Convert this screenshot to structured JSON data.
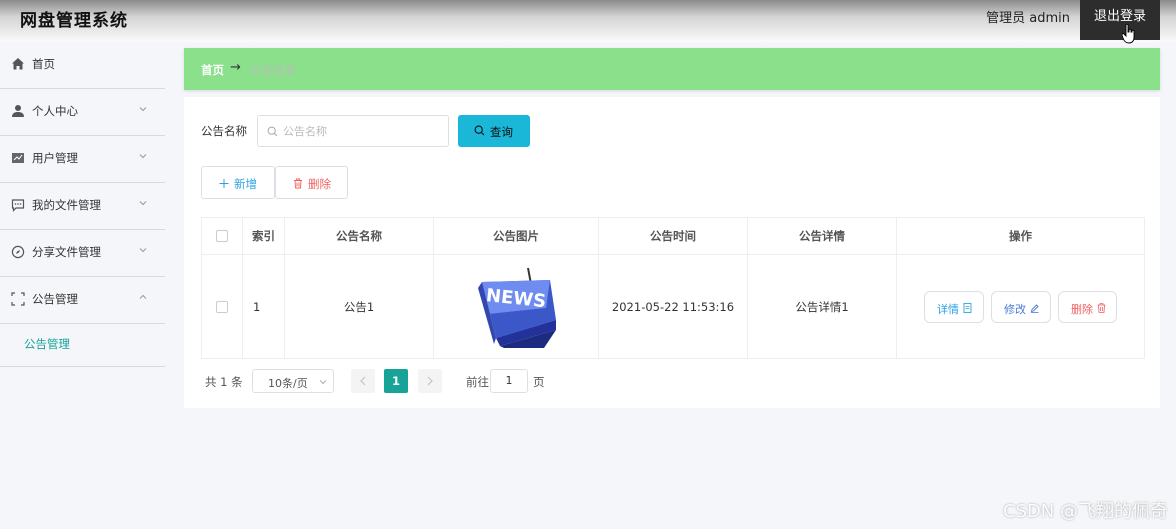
{
  "header": {
    "app_title": "网盘管理系统",
    "admin_label": "管理员 admin",
    "logout_label": "退出登录"
  },
  "sidebar": {
    "items": [
      {
        "label": "首页",
        "icon": "home-icon"
      },
      {
        "label": "个人中心",
        "icon": "user-icon"
      },
      {
        "label": "用户管理",
        "icon": "chart-icon"
      },
      {
        "label": "我的文件管理",
        "icon": "chat-icon"
      },
      {
        "label": "分享文件管理",
        "icon": "compass-icon"
      },
      {
        "label": "公告管理",
        "icon": "fullscreen-icon",
        "expanded": true
      }
    ],
    "sub_items": [
      {
        "label": "公告管理",
        "active": true
      }
    ]
  },
  "breadcrumb": {
    "home": "首页",
    "separator": "→",
    "current": "公告信息"
  },
  "search": {
    "label": "公告名称",
    "placeholder": "公告名称",
    "value": "",
    "button_label": "查询"
  },
  "actions": {
    "add_label": "新增",
    "delete_label": "删除"
  },
  "table": {
    "columns": [
      "索引",
      "公告名称",
      "公告图片",
      "公告时间",
      "公告详情",
      "操作"
    ],
    "rows": [
      {
        "index": "1",
        "name": "公告1",
        "image": "NEWS",
        "time": "2021-05-22 11:53:16",
        "detail": "公告详情1",
        "ops": {
          "detail": "详情",
          "edit": "修改",
          "delete": "删除"
        }
      }
    ]
  },
  "pagination": {
    "total": "共 1 条",
    "page_size": "10条/页",
    "current_page": "1",
    "goto_label": "前往",
    "goto_value": "1",
    "goto_suffix": "页"
  },
  "watermark": "CSDN @飞翔的佩奇",
  "colors": {
    "breadcrumb_bg": "#8be08b",
    "primary_teal": "#17a398",
    "query_button": "#1ab7d8",
    "danger": "#f06060",
    "info_blue": "#2ba1e4"
  }
}
